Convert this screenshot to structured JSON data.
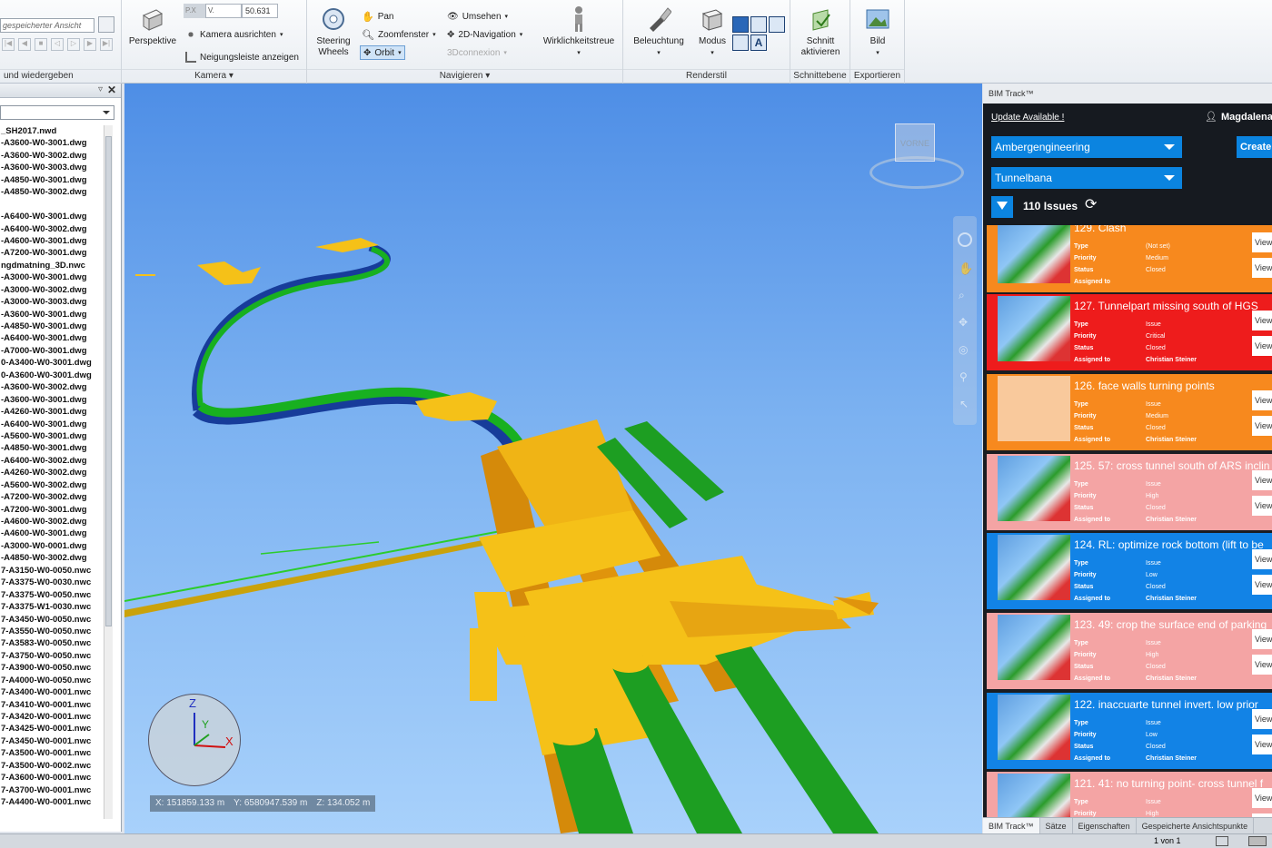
{
  "ribbon": {
    "saved_view_placeholder": "gespeicherter Ansicht",
    "view_group_label": "und wiedergeben",
    "field_px": "P.X",
    "field_v": "V.",
    "field_value": "50.631",
    "perspective_label": "Perspektive",
    "camera_align": "Kamera ausrichten",
    "tilt_bar": "Neigungsleiste anzeigen",
    "camera_group": "Kamera",
    "steering_wheels_1": "Steering",
    "steering_wheels_2": "Wheels",
    "pan": "Pan",
    "zoom_window": "Zoomfenster",
    "orbit": "Orbit",
    "turn_around": "Umsehen",
    "nav_2d": "2D-Navigation",
    "connexion": "3Dconnexion",
    "realism": "Wirklichkeitstreue",
    "navigate_group": "Navigieren",
    "lighting": "Beleuchtung",
    "mode": "Modus",
    "render_group": "Renderstil",
    "section_1": "Schnitt",
    "section_2": "aktivieren",
    "section_group": "Schnittebene",
    "image": "Bild",
    "export_group": "Exportieren"
  },
  "files": [
    "_SH2017.nwd",
    "-A3600-W0-3001.dwg",
    "-A3600-W0-3002.dwg",
    "-A3600-W0-3003.dwg",
    "-A4850-W0-3001.dwg",
    "-A4850-W0-3002.dwg",
    "",
    "-A6400-W0-3001.dwg",
    "-A6400-W0-3002.dwg",
    "-A4600-W0-3001.dwg",
    "-A7200-W0-3001.dwg",
    "ngdmatning_3D.nwc",
    "-A3000-W0-3001.dwg",
    "-A3000-W0-3002.dwg",
    "-A3000-W0-3003.dwg",
    "-A3600-W0-3001.dwg",
    "-A4850-W0-3001.dwg",
    "-A6400-W0-3001.dwg",
    "-A7000-W0-3001.dwg",
    "0-A3400-W0-3001.dwg",
    "0-A3600-W0-3001.dwg",
    "-A3600-W0-3002.dwg",
    "-A3600-W0-3001.dwg",
    "-A4260-W0-3001.dwg",
    "-A6400-W0-3001.dwg",
    "-A5600-W0-3001.dwg",
    "-A4850-W0-3001.dwg",
    "-A6400-W0-3002.dwg",
    "-A4260-W0-3002.dwg",
    "-A5600-W0-3002.dwg",
    "-A7200-W0-3002.dwg",
    "-A7200-W0-3001.dwg",
    "-A4600-W0-3002.dwg",
    "-A4600-W0-3001.dwg",
    "-A3000-W0-0001.dwg",
    "-A4850-W0-3002.dwg",
    "7-A3150-W0-0050.nwc",
    "7-A3375-W0-0030.nwc",
    "7-A3375-W0-0050.nwc",
    "7-A3375-W1-0030.nwc",
    "7-A3450-W0-0050.nwc",
    "7-A3550-W0-0050.nwc",
    "7-A3583-W0-0050.nwc",
    "7-A3750-W0-0050.nwc",
    "7-A3900-W0-0050.nwc",
    "7-A4000-W0-0050.nwc",
    "7-A3400-W0-0001.nwc",
    "7-A3410-W0-0001.nwc",
    "7-A3420-W0-0001.nwc",
    "7-A3425-W0-0001.nwc",
    "7-A3450-W0-0001.nwc",
    "7-A3500-W0-0001.nwc",
    "7-A3500-W0-0002.nwc",
    "7-A3600-W0-0001.nwc",
    "7-A3700-W0-0001.nwc",
    "7-A4400-W0-0001.nwc"
  ],
  "viewport": {
    "viewcube_label": "VORNE",
    "axis_z": "Z",
    "axis_y": "Y",
    "axis_x": "X",
    "coord_x": "X: 151859.133 m",
    "coord_y": "Y: 6580947.539 m",
    "coord_z": "Z: 134.052 m"
  },
  "bimtrack": {
    "panel_title": "BIM Track™",
    "update_link": "Update Available !",
    "user": "Magdalena",
    "company": "Ambergengineering",
    "project": "Tunnelbana",
    "create": "Create",
    "issue_count": "110 Issues",
    "field_labels": {
      "type": "Type",
      "priority": "Priority",
      "status": "Status",
      "assigned": "Assigned to"
    },
    "view_label": "View",
    "issues": [
      {
        "title": "129. Clash",
        "type": "(Not set)",
        "priority": "Medium",
        "status": "Closed",
        "assigned": "",
        "color": "#f7891e"
      },
      {
        "title": "127. Tunnelpart missing south of HGS",
        "type": "Issue",
        "priority": "Critical",
        "status": "Closed",
        "assigned": "Christian Steiner",
        "color": "#ee1c1c"
      },
      {
        "title": "126. face walls turning points",
        "type": "Issue",
        "priority": "Medium",
        "status": "Closed",
        "assigned": "Christian Steiner",
        "color": "#f7891e"
      },
      {
        "title": "125. 57: cross tunnel south of ARS inclin",
        "type": "Issue",
        "priority": "High",
        "status": "Closed",
        "assigned": "Christian Steiner",
        "color": "#f4a4a4"
      },
      {
        "title": "124. RL: optimize rock bottom (lift to be",
        "type": "Issue",
        "priority": "Low",
        "status": "Closed",
        "assigned": "Christian Steiner",
        "color": "#1283e6"
      },
      {
        "title": "123. 49: crop the surface end of parking",
        "type": "Issue",
        "priority": "High",
        "status": "Closed",
        "assigned": "Christian Steiner",
        "color": "#f4a4a4"
      },
      {
        "title": "122. inaccuarte tunnel invert. low prior",
        "type": "Issue",
        "priority": "Low",
        "status": "Closed",
        "assigned": "Christian Steiner",
        "color": "#1283e6"
      },
      {
        "title": "121. 41: no turning point- cross tunnel f",
        "type": "Issue",
        "priority": "High",
        "status": "",
        "assigned": "",
        "color": "#f4a4a4"
      }
    ]
  },
  "tabs": [
    "BIM Track™",
    "Sätze",
    "Eigenschaften",
    "Gespeicherte Ansichtspunkte"
  ],
  "status": {
    "page": "1 von 1"
  }
}
